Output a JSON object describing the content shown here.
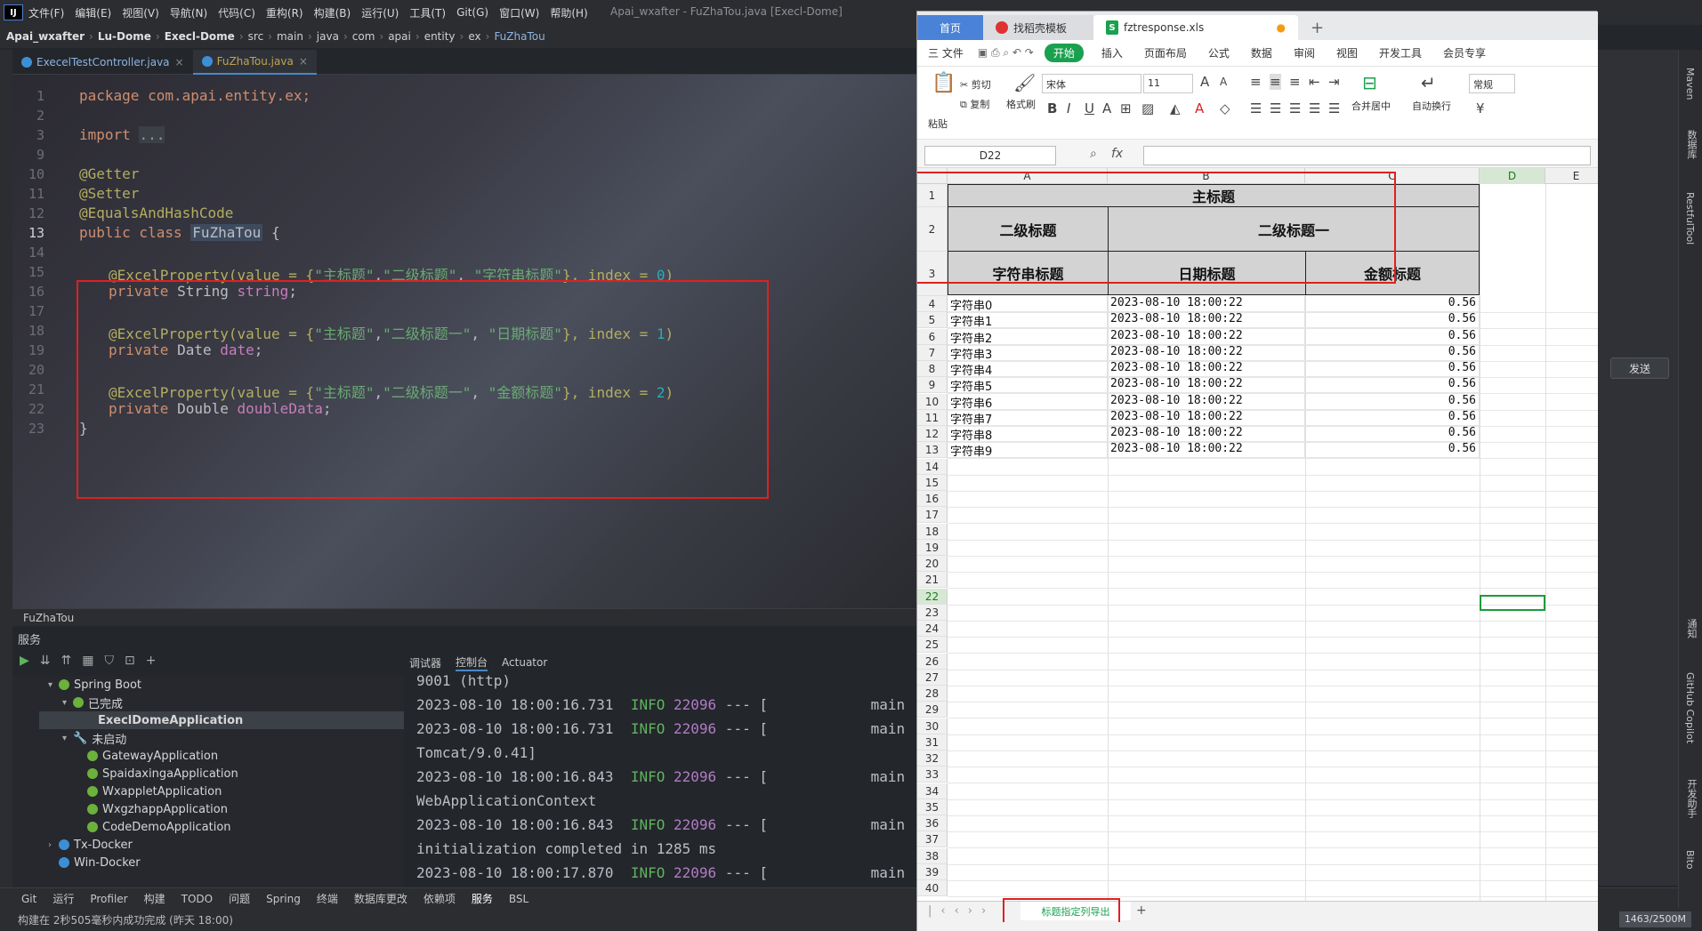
{
  "ide": {
    "menu": [
      "文件(F)",
      "编辑(E)",
      "视图(V)",
      "导航(N)",
      "代码(C)",
      "重构(R)",
      "构建(B)",
      "运行(U)",
      "工具(T)",
      "Git(G)",
      "窗口(W)",
      "帮助(H)"
    ],
    "window_title": "Apai_wxafter - FuZhaTou.java [Execl-Dome]",
    "breadcrumbs": [
      "Apai_wxafter",
      "Lu-Dome",
      "Execl-Dome",
      "src",
      "main",
      "java",
      "com",
      "apai",
      "entity",
      "ex",
      "FuZhaTou"
    ],
    "tabs": [
      "ExecelTestController.java",
      "FuZhaTou.java"
    ],
    "line_numbers": [
      "1",
      "2",
      "3",
      "9",
      "10",
      "11",
      "12",
      "13",
      "14",
      "15",
      "16",
      "17",
      "18",
      "19",
      "20",
      "21",
      "22",
      "23"
    ],
    "code": {
      "l1": "package com.apai.entity.ex;",
      "l3_kw": "import",
      "l3_fold": "...",
      "l10": "@Getter",
      "l11": "@Setter",
      "l12": "@EqualsAndHashCode",
      "l13_kw": "public class",
      "l13_name": "FuZhaTou",
      "l13_brace": "{",
      "l15": {
        "ann": "@ExcelProperty(value = {",
        "s1": "\"主标题\"",
        "s2": "\"二级标题\"",
        "s3": "\"字符串标题\"",
        "tail": "}, index = ",
        "idx": "0",
        "end": ")"
      },
      "l16": {
        "kw": "private",
        "type": "String",
        "field": "string",
        "end": ";"
      },
      "l18": {
        "ann": "@ExcelProperty(value = {",
        "s1": "\"主标题\"",
        "s2": "\"二级标题一\"",
        "s3": "\"日期标题\"",
        "tail": "}, index = ",
        "idx": "1",
        "end": ")"
      },
      "l19": {
        "kw": "private",
        "type": "Date",
        "field": "date",
        "end": ";"
      },
      "l21": {
        "ann": "@ExcelProperty(value = {",
        "s1": "\"主标题\"",
        "s2": "\"二级标题一\"",
        "s3": "\"金额标题\"",
        "tail": "}, index = ",
        "idx": "2",
        "end": ")"
      },
      "l22": {
        "kw": "private",
        "type": "Double",
        "field": "doubleData",
        "end": ";"
      },
      "l23": "}"
    },
    "file_label": "FuZhaTou",
    "services_title": "服务",
    "tree": {
      "spring_boot": "Spring Boot",
      "finished": "已完成",
      "running_app": "ExeclDomeApplication",
      "not_started": "未启动",
      "apps": [
        "GatewayApplication",
        "SpaidaxingaApplication",
        "WxappletApplication",
        "WxgzhappApplication",
        "CodeDemoApplication"
      ],
      "docker1": "Tx-Docker",
      "docker2": "Win-Docker"
    },
    "console_tabs": [
      "调试器",
      "控制台",
      "Actuator"
    ],
    "console": [
      {
        "text": "9001 (http)"
      },
      {
        "ts": "2023-08-10 18:00:16.731",
        "lvl": "INFO",
        "pid": "22096",
        "rest": "--- [",
        "thread": "main"
      },
      {
        "ts": "2023-08-10 18:00:16.731",
        "lvl": "INFO",
        "pid": "22096",
        "rest": "--- [",
        "thread": "main"
      },
      {
        "text": "Tomcat/9.0.41]"
      },
      {
        "ts": "2023-08-10 18:00:16.843",
        "lvl": "INFO",
        "pid": "22096",
        "rest": "--- [",
        "thread": "main"
      },
      {
        "text": "WebApplicationContext"
      },
      {
        "ts": "2023-08-10 18:00:16.843",
        "lvl": "INFO",
        "pid": "22096",
        "rest": "--- [",
        "thread": "main"
      },
      {
        "text": "initialization completed in 1285 ms"
      },
      {
        "ts": "2023-08-10 18:00:17.870",
        "lvl": "INFO",
        "pid": "22096",
        "rest": "--- [",
        "thread": "main"
      }
    ],
    "bottom_tools": [
      "Git",
      "运行",
      "Profiler",
      "构建",
      "TODO",
      "问题",
      "Spring",
      "终端",
      "数据库更改",
      "依赖项",
      "服务",
      "BSL"
    ],
    "status": "构建在 2秒505毫秒内成功完成 (昨天 18:00)",
    "memory": "1463/2500M",
    "right_tools": [
      "Maven",
      "数据库",
      "RestfulTool",
      "通知",
      "GitHub Copilot",
      "开发助手",
      "Bito"
    ],
    "send_button": "发送"
  },
  "wps": {
    "tabs": [
      "首页",
      "找稻壳模板",
      "fztresponse.xls"
    ],
    "menu": [
      "三 文件",
      "开始",
      "插入",
      "页面布局",
      "公式",
      "数据",
      "审阅",
      "视图",
      "开发工具",
      "会员专享"
    ],
    "ribbon": {
      "paste": "粘贴",
      "cut": "剪切",
      "copy": "复制",
      "format_painter": "格式刷",
      "font": "宋体",
      "size": "11",
      "merge": "合并居中",
      "wrap": "自动换行",
      "number_format": "常规"
    },
    "namebox": "D22",
    "fx": "fx",
    "columns": [
      "A",
      "B",
      "C",
      "D",
      "E"
    ],
    "header": {
      "main": "主标题",
      "sub_a": "二级标题",
      "sub_bc": "二级标题一",
      "col_a": "字符串标题",
      "col_b": "日期标题",
      "col_c": "金额标题"
    },
    "rows": [
      {
        "a": "字符串0",
        "b": "2023-08-10 18:00:22",
        "c": "0.56"
      },
      {
        "a": "字符串1",
        "b": "2023-08-10 18:00:22",
        "c": "0.56"
      },
      {
        "a": "字符串2",
        "b": "2023-08-10 18:00:22",
        "c": "0.56"
      },
      {
        "a": "字符串3",
        "b": "2023-08-10 18:00:22",
        "c": "0.56"
      },
      {
        "a": "字符串4",
        "b": "2023-08-10 18:00:22",
        "c": "0.56"
      },
      {
        "a": "字符串5",
        "b": "2023-08-10 18:00:22",
        "c": "0.56"
      },
      {
        "a": "字符串6",
        "b": "2023-08-10 18:00:22",
        "c": "0.56"
      },
      {
        "a": "字符串7",
        "b": "2023-08-10 18:00:22",
        "c": "0.56"
      },
      {
        "a": "字符串8",
        "b": "2023-08-10 18:00:22",
        "c": "0.56"
      },
      {
        "a": "字符串9",
        "b": "2023-08-10 18:00:22",
        "c": "0.56"
      }
    ],
    "sheet_tab": "标题指定列导出"
  }
}
